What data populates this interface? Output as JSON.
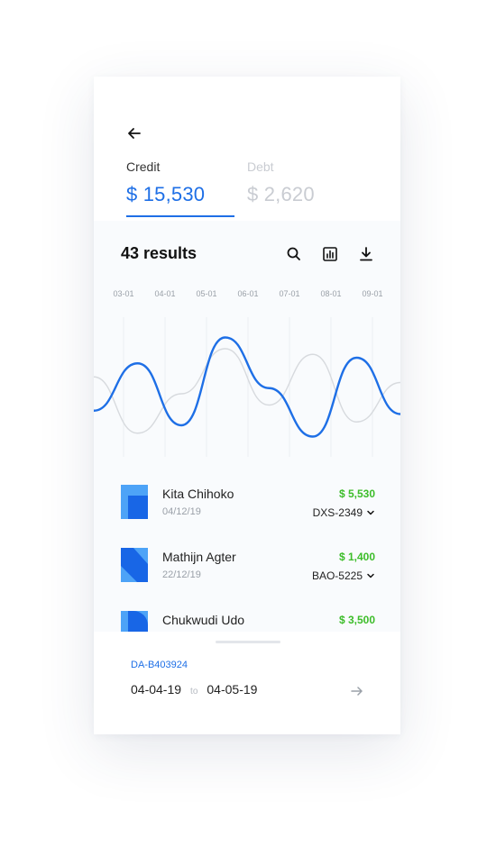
{
  "header": {
    "back_icon": "arrow-left-icon"
  },
  "tabs": [
    {
      "label": "Credit",
      "amount": "$ 15,530",
      "active": true
    },
    {
      "label": "Debt",
      "amount": "$ 2,620",
      "active": false
    }
  ],
  "results": {
    "count_label": "43 results"
  },
  "toolbar": {
    "search_icon": "search-icon",
    "chart_icon": "bar-chart-icon",
    "download_icon": "download-icon"
  },
  "chart_data": {
    "type": "line",
    "x_ticks": [
      "03-01",
      "04-01",
      "05-01",
      "06-01",
      "07-01",
      "08-01",
      "09-01"
    ],
    "grid": "vertical",
    "colors": {
      "primary": "#1e6fe6",
      "secondary": "#d7dade"
    },
    "series": [
      {
        "values": [
          0.25,
          0.67,
          0.12,
          0.9,
          0.45,
          0.02,
          0.72,
          0.22
        ]
      },
      {
        "values": [
          0.55,
          0.05,
          0.4,
          0.8,
          0.3,
          0.75,
          0.15,
          0.5
        ]
      }
    ]
  },
  "transactions": [
    {
      "name": "Kita Chihoko",
      "date": "04/12/19",
      "amount": "$ 5,530",
      "code": "DXS-2349"
    },
    {
      "name": "Mathijn Agter",
      "date": "22/12/19",
      "amount": "$ 1,400",
      "code": "BAO-5225"
    },
    {
      "name": "Chukwudi Udo",
      "date": "",
      "amount": "$ 3,500",
      "code": ""
    }
  ],
  "footer": {
    "reference": "DA-B403924",
    "from_date": "04-04-19",
    "to_word": "to",
    "to_date": "04-05-19",
    "next_icon": "arrow-right-icon"
  },
  "colors": {
    "accent": "#1e6fe6",
    "positive": "#3dbd2a",
    "muted": "#c9ccd2"
  }
}
